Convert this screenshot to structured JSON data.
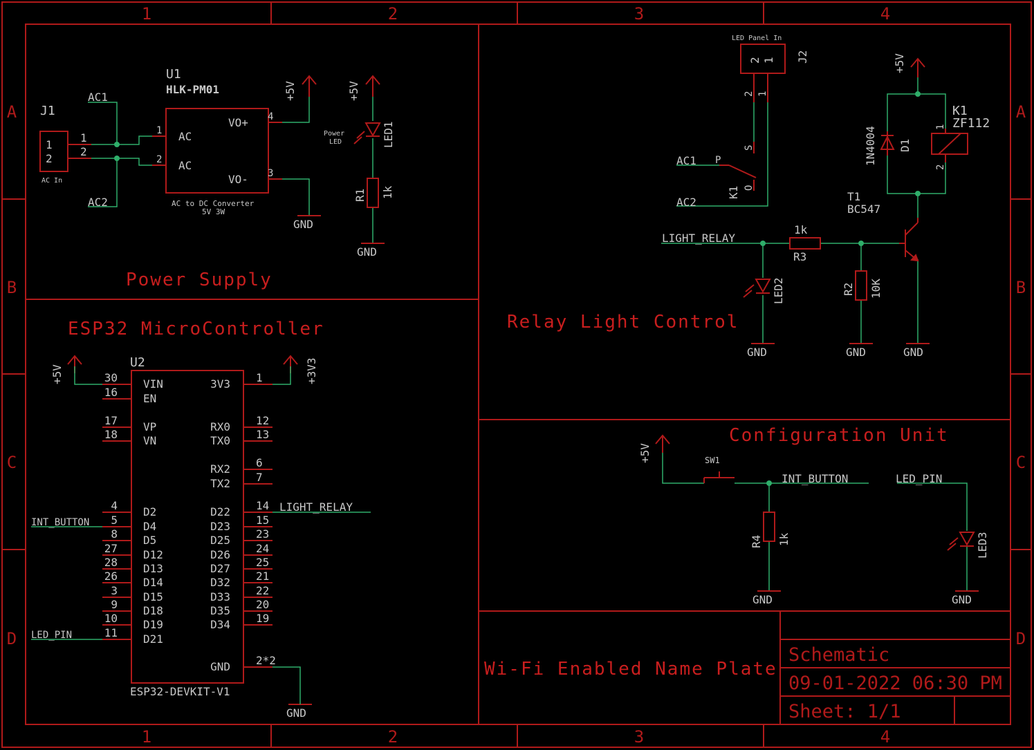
{
  "colors": {
    "background": "#000000",
    "frame": "#b01a1a",
    "wire": "#2fae6a",
    "text": "#c8c8c8"
  },
  "border": {
    "columns": [
      "1",
      "2",
      "3",
      "4"
    ],
    "rows": [
      "A",
      "B",
      "C",
      "D"
    ]
  },
  "sections": {
    "power": "Power Supply",
    "esp": "ESP32 MicroController",
    "relay": "Relay Light Control",
    "config": "Configuration Unit"
  },
  "title_block": {
    "project": "Wi-Fi Enabled Name Plate",
    "type": "Schematic",
    "datetime": "09-01-2022 06:30 PM",
    "sheet": "Sheet: 1/1"
  },
  "power": {
    "j1": {
      "name": "J1",
      "pins": [
        "1",
        "2"
      ],
      "caption": "AC In"
    },
    "u1": {
      "name": "U1",
      "value": "HLK-PM01",
      "caption1": "AC to DC Converter",
      "caption2": "5V 3W",
      "pins": [
        "AC",
        "AC",
        "VO+",
        "VO-"
      ],
      "pin_numbers": [
        "1",
        "2",
        "4",
        "3"
      ]
    },
    "nets": {
      "ac1": "AC1",
      "ac2": "AC2",
      "vcc": "+5V",
      "gnd": "GND"
    },
    "led1": {
      "name": "LED1",
      "caption1": "Power",
      "caption2": "LED"
    },
    "r1": {
      "name": "R1",
      "value": "1k"
    }
  },
  "esp": {
    "name": "U2",
    "value": "ESP32-DEVKIT-V1",
    "left_pins": [
      {
        "label": "VIN",
        "num": "30"
      },
      {
        "label": "EN",
        "num": "16"
      },
      {
        "label": "VP",
        "num": "17"
      },
      {
        "label": "VN",
        "num": "18"
      },
      {
        "label": "D2",
        "num": "4"
      },
      {
        "label": "D4",
        "num": "5"
      },
      {
        "label": "D5",
        "num": "8"
      },
      {
        "label": "D12",
        "num": "27"
      },
      {
        "label": "D13",
        "num": "28"
      },
      {
        "label": "D14",
        "num": "26"
      },
      {
        "label": "D15",
        "num": "3"
      },
      {
        "label": "D18",
        "num": "9"
      },
      {
        "label": "D19",
        "num": "10"
      },
      {
        "label": "D21",
        "num": "11"
      }
    ],
    "right_pins": [
      {
        "label": "3V3",
        "num": "1"
      },
      {
        "label": "RX0",
        "num": "12"
      },
      {
        "label": "TX0",
        "num": "13"
      },
      {
        "label": "RX2",
        "num": "6"
      },
      {
        "label": "TX2",
        "num": "7"
      },
      {
        "label": "D22",
        "num": "14"
      },
      {
        "label": "D23",
        "num": "15"
      },
      {
        "label": "D25",
        "num": "23"
      },
      {
        "label": "D26",
        "num": "24"
      },
      {
        "label": "D27",
        "num": "25"
      },
      {
        "label": "D32",
        "num": "21"
      },
      {
        "label": "D33",
        "num": "22"
      },
      {
        "label": "D35",
        "num": "20"
      },
      {
        "label": "D34",
        "num": "19"
      },
      {
        "label": "GND",
        "num": "2*2"
      }
    ],
    "nets": {
      "vcc": "+5V",
      "v33": "+3V3",
      "gnd": "GND",
      "int_button": "INT_BUTTON",
      "led_pin": "LED_PIN",
      "light_relay": "LIGHT_RELAY"
    }
  },
  "relay": {
    "j2": {
      "name": "J2",
      "caption": "LED Panel In",
      "pins": [
        "2",
        "1"
      ]
    },
    "k1": {
      "name": "K1",
      "value": "ZF112",
      "contacts": [
        "P",
        "S",
        "O"
      ],
      "coil_pins": [
        "1",
        "2"
      ]
    },
    "d1": {
      "name": "D1",
      "value": "1N4004"
    },
    "t1": {
      "name": "T1",
      "value": "BC547"
    },
    "r3": {
      "name": "R3",
      "value": "1k"
    },
    "r2": {
      "name": "R2",
      "value": "10K"
    },
    "led2": {
      "name": "LED2"
    },
    "nets": {
      "ac1": "AC1",
      "ac2": "AC2",
      "vcc": "+5V",
      "gnd": "GND",
      "light_relay": "LIGHT_RELAY"
    }
  },
  "config": {
    "sw1": {
      "name": "SW1"
    },
    "r4": {
      "name": "R4",
      "value": "1k"
    },
    "led3": {
      "name": "LED3"
    },
    "nets": {
      "vcc": "+5V",
      "gnd": "GND",
      "int_button": "INT_BUTTON",
      "led_pin": "LED_PIN"
    }
  }
}
